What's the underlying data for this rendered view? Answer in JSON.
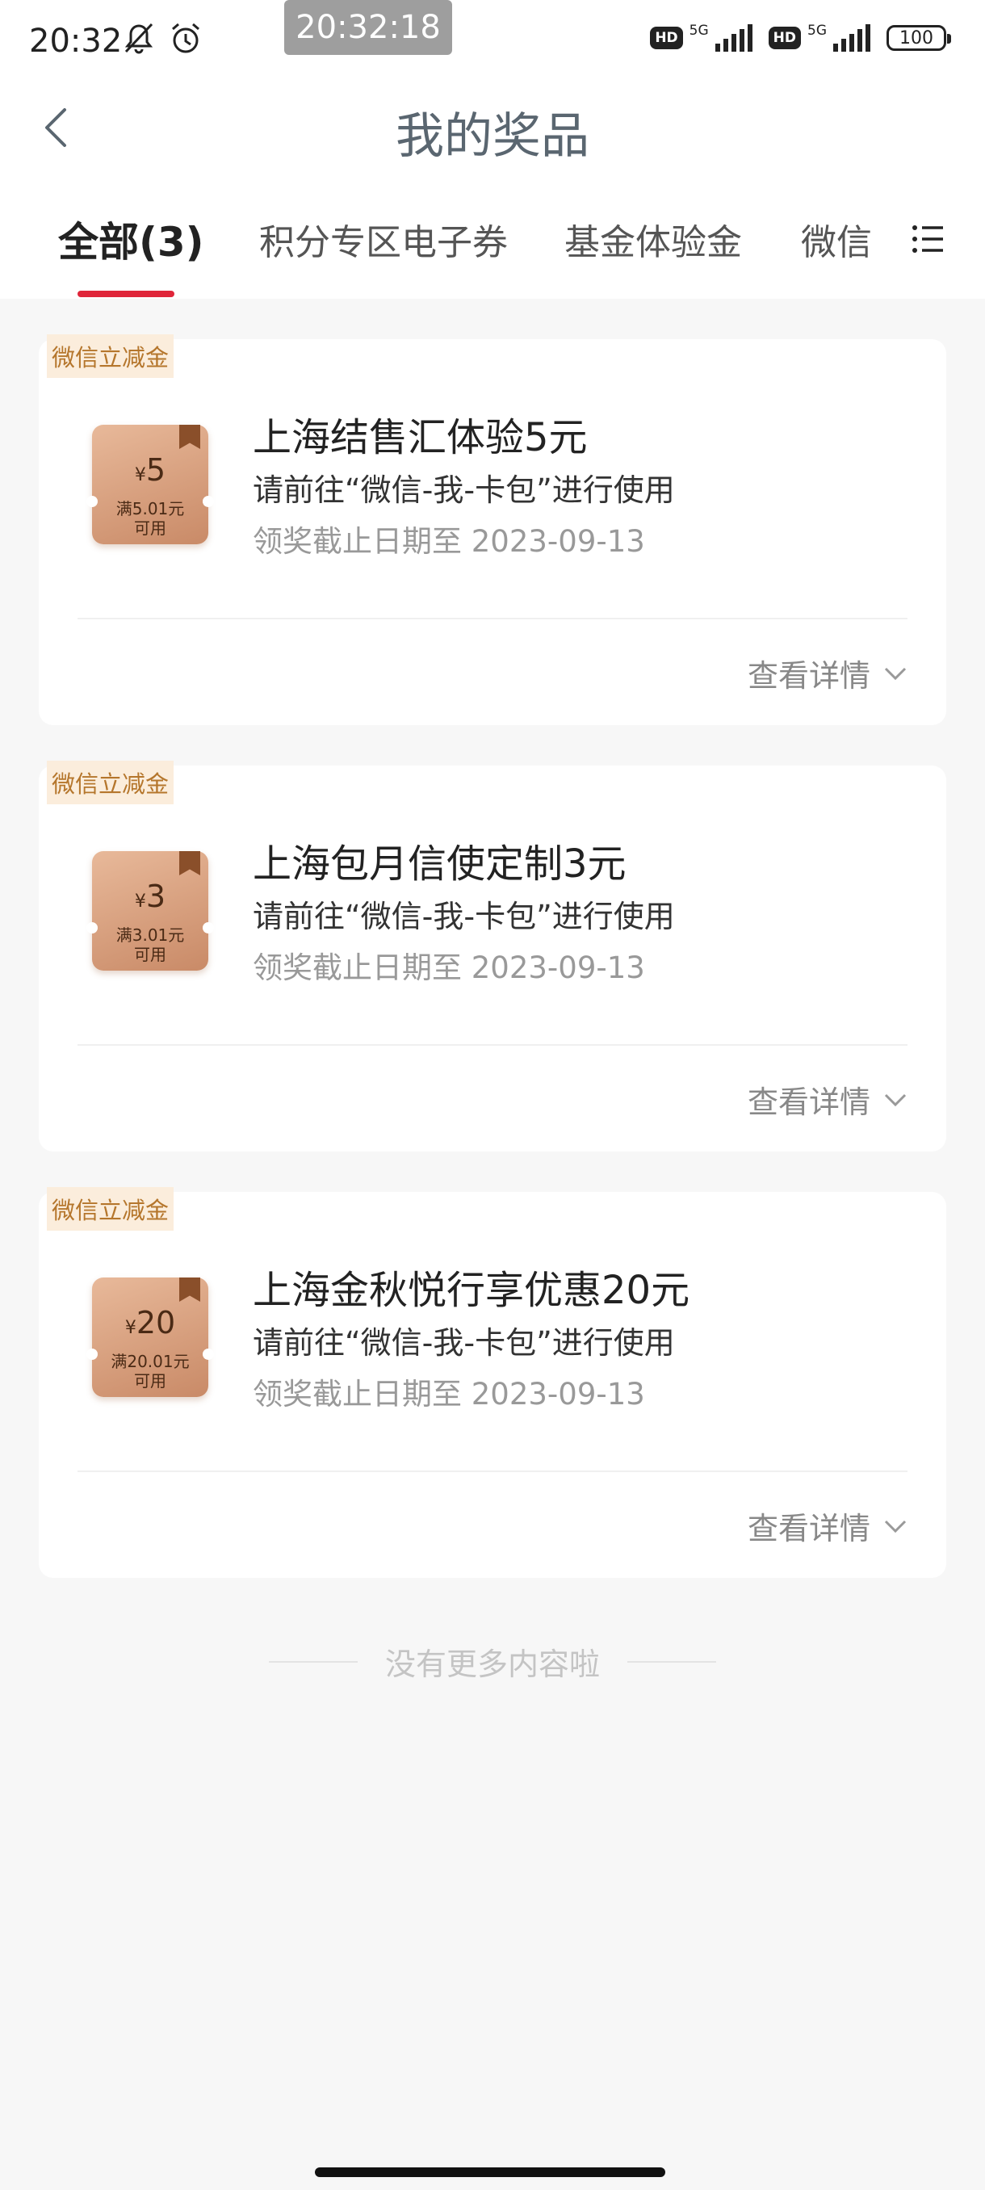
{
  "status_bar": {
    "time": "20:32",
    "clock_chip": "20:32:18",
    "network_1": "5G",
    "network_2": "5G",
    "hd_1": "HD",
    "hd_2": "HD",
    "battery": "100",
    "icons": [
      "mute-icon",
      "alarm-icon",
      "signal-icon",
      "battery-icon"
    ]
  },
  "header": {
    "title": "我的奖品",
    "back_icon": "chevron-left-icon"
  },
  "tabs": {
    "items": [
      {
        "label": "全部(3)",
        "active": true
      },
      {
        "label": "积分专区电子券",
        "active": false
      },
      {
        "label": "基金体验金",
        "active": false
      },
      {
        "label": "微信",
        "active": false
      }
    ],
    "menu_icon": "list-menu-icon",
    "accent_color": "#e0263a"
  },
  "prizes": [
    {
      "tag": "微信立减金",
      "currency": "¥",
      "amount": "5",
      "condition_line1": "满5.01元",
      "condition_line2": "可用",
      "title": "上海结售汇体验5元",
      "desc": "请前往“微信-我-卡包”进行使用",
      "deadline": "领奖截止日期至 2023-09-13",
      "detail_label": "查看详情"
    },
    {
      "tag": "微信立减金",
      "currency": "¥",
      "amount": "3",
      "condition_line1": "满3.01元",
      "condition_line2": "可用",
      "title": "上海包月信使定制3元",
      "desc": "请前往“微信-我-卡包”进行使用",
      "deadline": "领奖截止日期至 2023-09-13",
      "detail_label": "查看详情"
    },
    {
      "tag": "微信立减金",
      "currency": "¥",
      "amount": "20",
      "condition_line1": "满20.01元",
      "condition_line2": "可用",
      "title": "上海金秋悦行享优惠20元",
      "desc": "请前往“微信-我-卡包”进行使用",
      "deadline": "领奖截止日期至 2023-09-13",
      "detail_label": "查看详情"
    }
  ],
  "footer": {
    "end_text": "没有更多内容啦"
  }
}
